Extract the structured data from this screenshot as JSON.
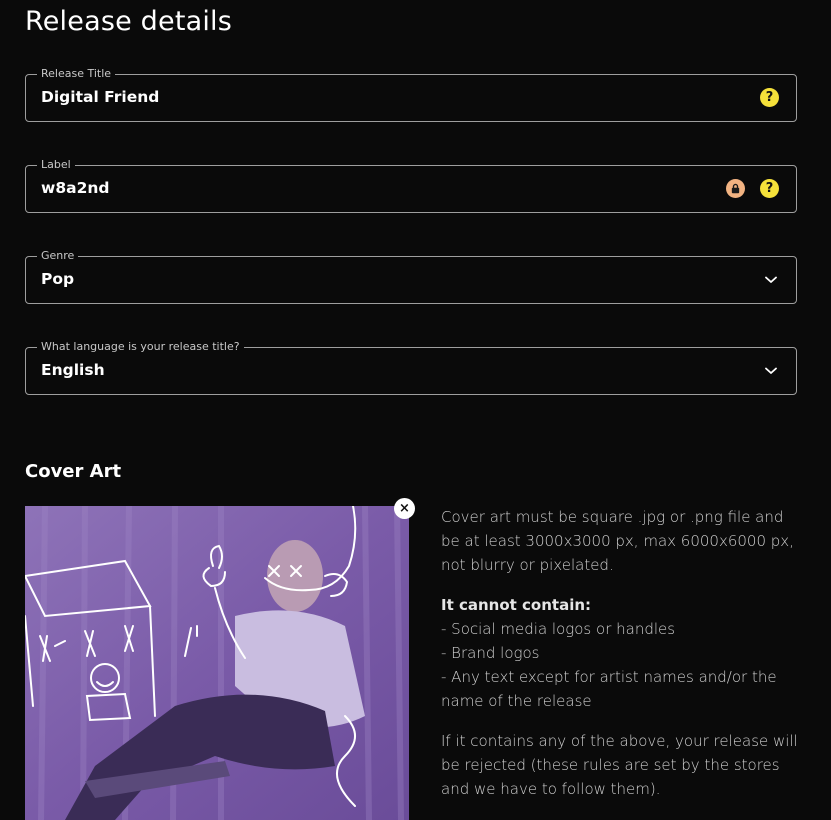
{
  "page": {
    "title": "Release details"
  },
  "fields": {
    "release_title": {
      "label": "Release Title",
      "value": "Digital Friend",
      "help": "?"
    },
    "label": {
      "label": "Label",
      "value": "w8a2nd",
      "help": "?"
    },
    "genre": {
      "label": "Genre",
      "value": "Pop"
    },
    "language": {
      "label": "What language is your release title?",
      "value": "English"
    }
  },
  "cover_art": {
    "title": "Cover Art",
    "remove_symbol": "×",
    "rules": {
      "intro": "Cover art must be square .jpg or .png file and be at least 3000x3000 px, max 6000x6000 px, not blurry or pixelated.",
      "cannot_title": "It cannot contain:",
      "cannot_items": [
        "- Social media logos or handles",
        "- Brand logos",
        "- Any text except for artist names and/or the name of the release"
      ],
      "rejection": "If it contains any of the above, your release will be rejected (these rules are set by the stores and we have to follow them)."
    }
  },
  "colors": {
    "background": "#0a0a0a",
    "field_border": "#9e9e9e",
    "help_icon": "#f5e13a",
    "lock_icon": "#f2b382",
    "cover_purple": "#7b5ca8"
  },
  "icons": [
    "help-icon",
    "lock-icon",
    "chevron-down-icon",
    "close-icon"
  ]
}
